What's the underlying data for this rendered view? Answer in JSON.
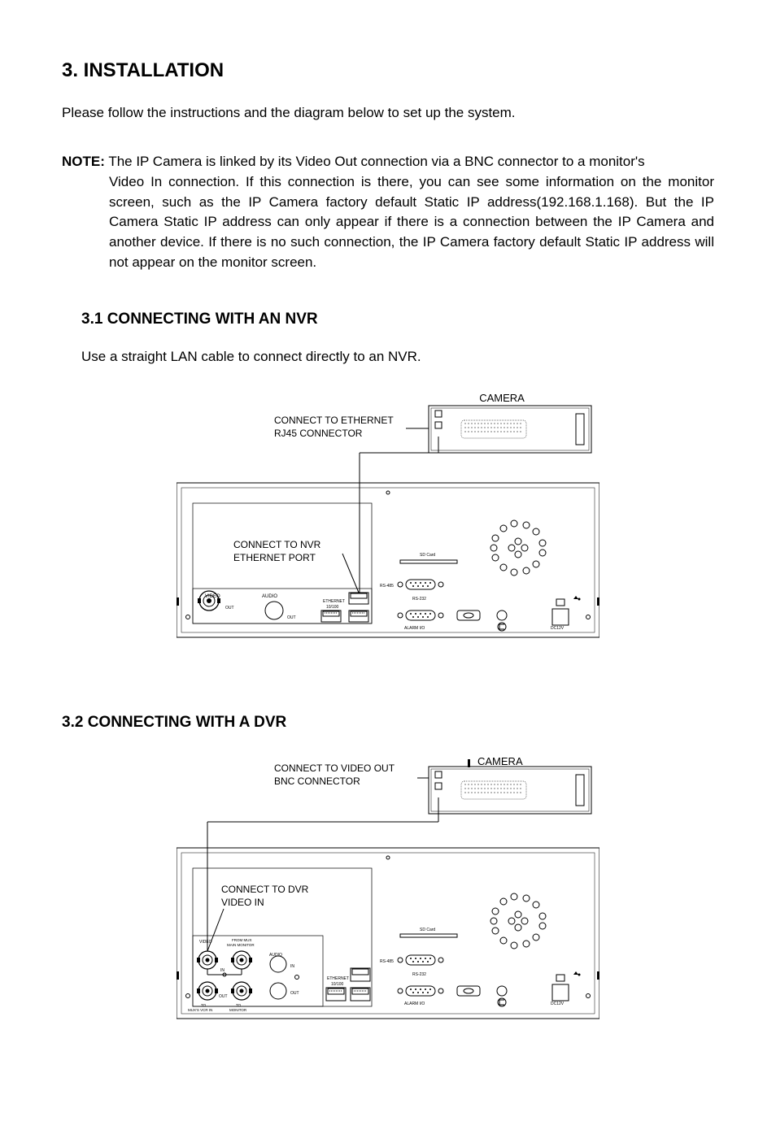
{
  "title": "3. INSTALLATION",
  "intro": "Please follow the instructions and the diagram below to set up the system.",
  "note_label": "NOTE:",
  "note_body": "The IP Camera is linked by its Video Out connection via a BNC connector to a monitor's Video In connection. If this connection is there, you can see some information on the monitor screen, such as the IP Camera factory default Static IP address(192.168.1.168). But the IP Camera Static IP address can only appear if there is a connection between the IP Camera and another device. If there is no such connection, the IP Camera factory default Static IP address will not appear on the monitor screen.",
  "section_3_1": "3.1 CONNECTING WITH AN NVR",
  "sub_3_1_intro": "Use a straight LAN cable to connect directly to an NVR.",
  "section_3_2": "3.2 CONNECTING WITH A DVR",
  "diagrams": {
    "nvr": {
      "camera_label": "CAMERA",
      "connect_ethernet": "CONNECT TO ETHERNET",
      "rj45": "RJ45 CONNECTOR",
      "connect_nvr": "CONNECT TO NVR",
      "ethernet_port": "ETHERNET PORT",
      "panel": {
        "video": "VIDEO",
        "audio": "AUDIO",
        "out1": "OUT",
        "out2": "OUT",
        "ethernet": "ETHERNET",
        "eth_speed": "10/100",
        "sd": "SD Card",
        "rs485": "RS-485",
        "rs232": "RS-232",
        "alarm": "ALARM  I/O",
        "dc12v": "DC12V"
      }
    },
    "dvr": {
      "camera_label": "CAMERA",
      "connect_video": "CONNECT TO VIDEO OUT",
      "bnc": "BNC CONNECTOR",
      "connect_dvr": "CONNECT TO DVR",
      "video_in": "VIDEO IN",
      "panel": {
        "video": "VIDEO",
        "from_mux": "FROM MUX",
        "main_monitor": "MAIN MONITOR",
        "audio": "AUDIO",
        "in1": "IN",
        "in2": "IN",
        "out1": "OUT",
        "out2": "OUT",
        "to_mux": "TO",
        "mux_vcr": "MUX'S VCR IN",
        "to_monitor": "TO",
        "monitor": "MONITOR",
        "ethernet": "ETHERNET",
        "eth_speed": "10/100",
        "sd": "SD Card",
        "rs485": "RS-485",
        "rs232": "RS-232",
        "alarm": "ALARM  I/O",
        "dc12v": "DC12V"
      }
    }
  }
}
